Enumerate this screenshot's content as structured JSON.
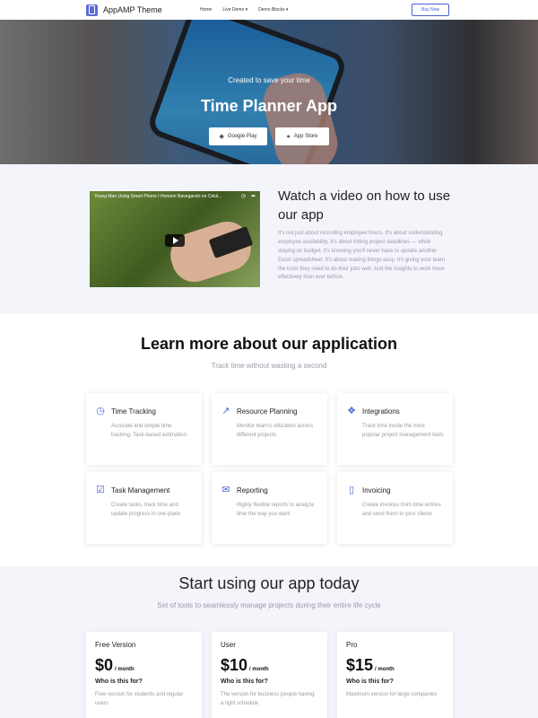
{
  "nav": {
    "brand": "AppAMP Theme",
    "links": [
      {
        "label": "Home",
        "caret": ""
      },
      {
        "label": "Live Demo",
        "caret": "▾"
      },
      {
        "label": "Demo Blocks",
        "caret": "▾"
      }
    ],
    "buy_label": "Buy Now"
  },
  "hero": {
    "subtitle": "Created to save your time",
    "title": "Time Planner App",
    "google_play": "Google Play",
    "app_store": "App Store"
  },
  "video": {
    "video_title": "Young Man Using Smart Phone I Homem Navegando no Celul...",
    "heading": "Watch a video on how to use our app",
    "text": "It's not just about recording employee hours. It's about understanding employee availability. It's about hitting project deadlines — while staying on budget. It's knowing you'll never have to update another Excel spreadsheet. It's about making things easy. It's giving your team the tools they need to do their jobs well. And the insights to work more effectively than ever before."
  },
  "features": {
    "title": "Learn more about our application",
    "subtitle": "Track time without wasting a second",
    "items": [
      {
        "icon": "clock-icon",
        "glyph": "◷",
        "title": "Time Tracking",
        "desc": "Accurate and simple time tracking. Task-based estimation"
      },
      {
        "icon": "external-link-icon",
        "glyph": "↗",
        "title": "Resource Planning",
        "desc": "Monitor team's utilization across different projects"
      },
      {
        "icon": "cubes-icon",
        "glyph": "❖",
        "title": "Integrations",
        "desc": "Track time inside the most popular project management tools"
      },
      {
        "icon": "checkbox-icon",
        "glyph": "☑",
        "title": "Task Management",
        "desc": "Create tasks, track time and update progress in one place"
      },
      {
        "icon": "chat-icon",
        "glyph": "✉",
        "title": "Reporting",
        "desc": "Highly flexible reports to analyze time the way you want"
      },
      {
        "icon": "document-icon",
        "glyph": "▯",
        "title": "Invoicing",
        "desc": "Create invoices from time entries and send them to your clients"
      }
    ]
  },
  "pricing": {
    "title": "Start using our app today",
    "subtitle": "Set of tools to seamlessly manage projects during their entire life cycle",
    "plans": [
      {
        "name": "Free Version",
        "amount": "$0",
        "per": "/ month",
        "who": "Who is this for?",
        "desc": "Free version for students and regular users"
      },
      {
        "name": "User",
        "amount": "$10",
        "per": "/ month",
        "who": "Who is this for?",
        "desc": "The version for business people having a tight schedule"
      },
      {
        "name": "Pro",
        "amount": "$15",
        "per": "/ month",
        "who": "Who is this for?",
        "desc": "Maximum version for large companies"
      }
    ]
  }
}
